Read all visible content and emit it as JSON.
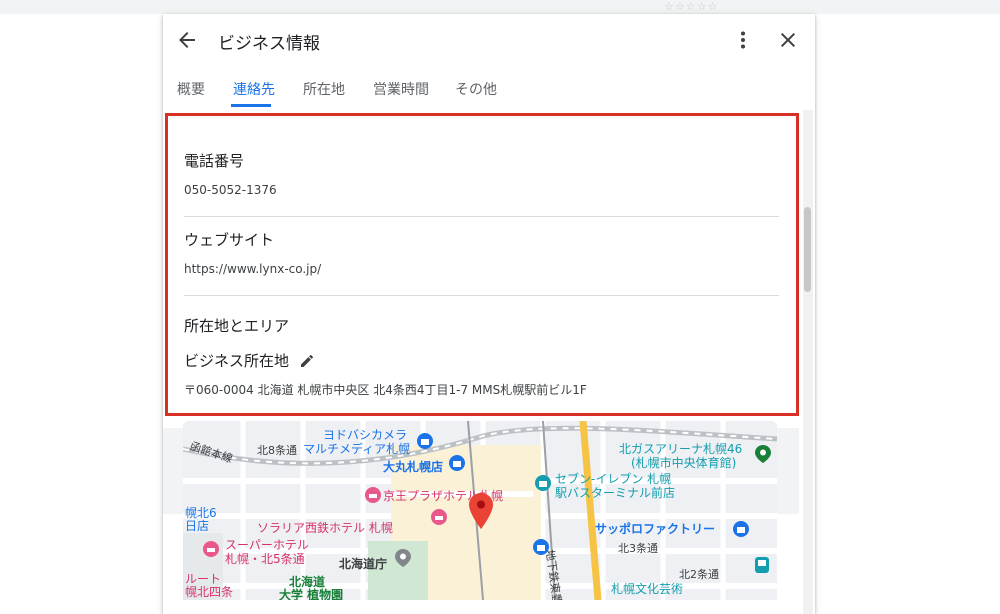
{
  "window": {
    "title": "ビジネス情報"
  },
  "tabs": [
    {
      "label": "概要",
      "active": false
    },
    {
      "label": "連絡先",
      "active": true
    },
    {
      "label": "所在地",
      "active": false
    },
    {
      "label": "営業時間",
      "active": false
    },
    {
      "label": "その他",
      "active": false
    }
  ],
  "contact": {
    "phone_label": "電話番号",
    "phone_value": "050-5052-1376",
    "website_label": "ウェブサイト",
    "website_value": "https://www.lynx-co.jp/",
    "location_section_label": "所在地とエリア",
    "business_address_label": "ビジネス所在地",
    "business_address_value": "〒060-0004 北海道 札幌市中央区 北4条西4丁目1-7 MMS札幌駅前ビル1F"
  },
  "map": {
    "labels": {
      "yodobashi": "ヨドバシカメラ",
      "yodobashi2": "マルチメディア札幌",
      "daimaru": "大丸札幌店",
      "kita8": "北8条通",
      "hakodate": "函館本線",
      "keio": "京王プラザホテル札幌",
      "sorarea": "ソラリア西鉄ホテル 札幌",
      "super_hotel": "スーパーホテル",
      "super_hotel2": "札幌・北5条通",
      "hokkaido_gov": "北海道庁",
      "hokudai": "北海道",
      "hokudai2": "大学 植物園",
      "route": "ルート",
      "route2": "幌北四条",
      "hokkaido_north6": "幌北6",
      "hokkaido_north6b": "日店",
      "seven": "セブン-イレブン 札幌",
      "seven2": "駅バスターミナル前店",
      "sapporo_factory": "サッポロファクトリー",
      "kita3": "北3条通",
      "kita2": "北2条通",
      "arena": "北ガスアリーナ札幌46",
      "arena2": "(札幌市中央体育館)",
      "chikatetsu": "地下鉄東豊線",
      "bunka": "札幌文化芸術"
    }
  },
  "colors": {
    "accent": "#1a73e8",
    "highlight_border": "#d93025",
    "map_pin": "#ea4335"
  }
}
